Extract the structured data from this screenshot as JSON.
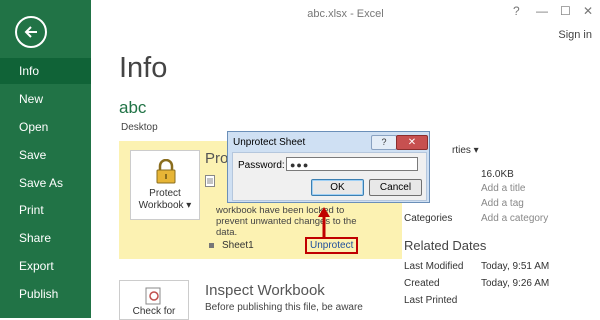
{
  "window": {
    "title": "abc.xlsx - Excel",
    "help": "?",
    "minimize": "—",
    "restore": "☐",
    "close": "✕",
    "sign_in": "Sign in"
  },
  "nav": {
    "items": [
      {
        "label": "Info",
        "active": true
      },
      {
        "label": "New"
      },
      {
        "label": "Open"
      },
      {
        "label": "Save"
      },
      {
        "label": "Save As"
      },
      {
        "label": "Print"
      },
      {
        "label": "Share"
      },
      {
        "label": "Export"
      },
      {
        "label": "Publish"
      }
    ]
  },
  "info": {
    "title": "Info",
    "file_name": "abc",
    "location": "Desktop"
  },
  "protect": {
    "button_label": "Protect Workbook ▾",
    "heading": "Pro",
    "description": "workbook have been locked to prevent unwanted changes to the data.",
    "sheet_name": "Sheet1",
    "unprotect_label": "Unprotect"
  },
  "inspect": {
    "button_label": "Check for",
    "heading": "Inspect Workbook",
    "description": "Before publishing this file, be aware"
  },
  "properties": {
    "title": "rties ▾",
    "rows": [
      {
        "label": "",
        "value": "16.0KB"
      },
      {
        "label": "",
        "value": "Add a title"
      },
      {
        "label": "",
        "value": "Add a tag"
      },
      {
        "label": "Categories",
        "value": "Add a category"
      }
    ]
  },
  "related_dates": {
    "title": "Related Dates",
    "rows": [
      {
        "label": "Last Modified",
        "value": "Today, 9:51 AM"
      },
      {
        "label": "Created",
        "value": "Today, 9:26 AM"
      },
      {
        "label": "Last Printed",
        "value": ""
      }
    ]
  },
  "dialog": {
    "title": "Unprotect Sheet",
    "help": "?",
    "close": "✕",
    "password_label": "Password:",
    "password_value": "●●●",
    "ok_label": "OK",
    "cancel_label": "Cancel"
  },
  "colors": {
    "nav_bg": "#217346",
    "nav_active": "#106337",
    "panel_bg": "#fcf2b2",
    "highlight": "#c00000",
    "accent": "#217346"
  }
}
